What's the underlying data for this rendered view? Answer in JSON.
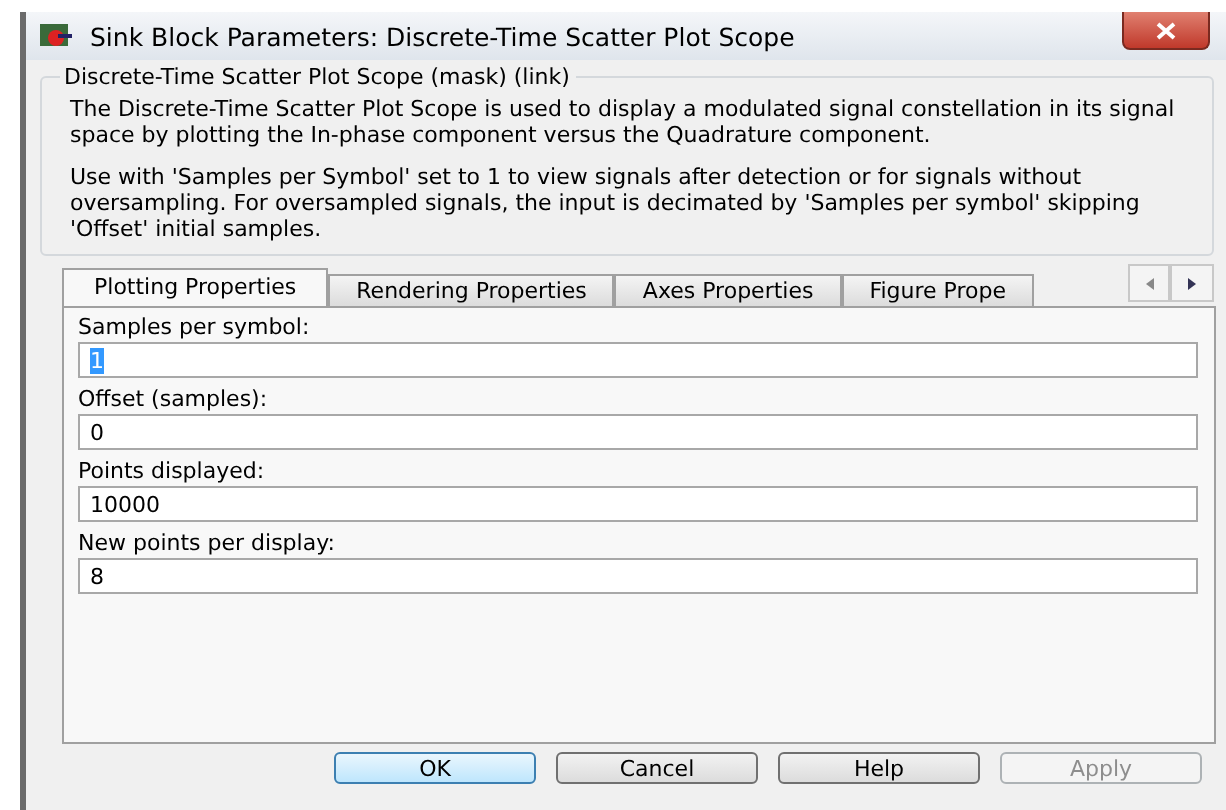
{
  "window": {
    "title": "Sink Block Parameters: Discrete-Time Scatter Plot Scope"
  },
  "description": {
    "heading": "Discrete-Time Scatter Plot Scope (mask) (link)",
    "paragraphs": [
      "The Discrete-Time Scatter Plot Scope is used to display a modulated signal constellation in its signal space by plotting the In-phase component versus the Quadrature component.",
      "Use with 'Samples per Symbol' set to 1 to view signals after detection or for signals without oversampling.  For oversampled signals, the input is decimated by 'Samples per symbol' skipping 'Offset' initial samples."
    ]
  },
  "tabs": [
    {
      "label": "Plotting Properties",
      "selected": true
    },
    {
      "label": "Rendering Properties",
      "selected": false
    },
    {
      "label": "Axes Properties",
      "selected": false
    },
    {
      "label": "Figure Prope",
      "selected": false
    }
  ],
  "fields": [
    {
      "label": "Samples per symbol:",
      "value": "1",
      "text_selected": true
    },
    {
      "label": "Offset (samples):",
      "value": "0",
      "text_selected": false
    },
    {
      "label": "Points displayed:",
      "value": "10000",
      "text_selected": false
    },
    {
      "label": "New points per display:",
      "value": "8",
      "text_selected": false
    }
  ],
  "buttons": [
    {
      "label": "OK",
      "default": true,
      "disabled": false
    },
    {
      "label": "Cancel",
      "default": false,
      "disabled": false
    },
    {
      "label": "Help",
      "default": false,
      "disabled": false
    },
    {
      "label": "Apply",
      "default": false,
      "disabled": true
    }
  ]
}
